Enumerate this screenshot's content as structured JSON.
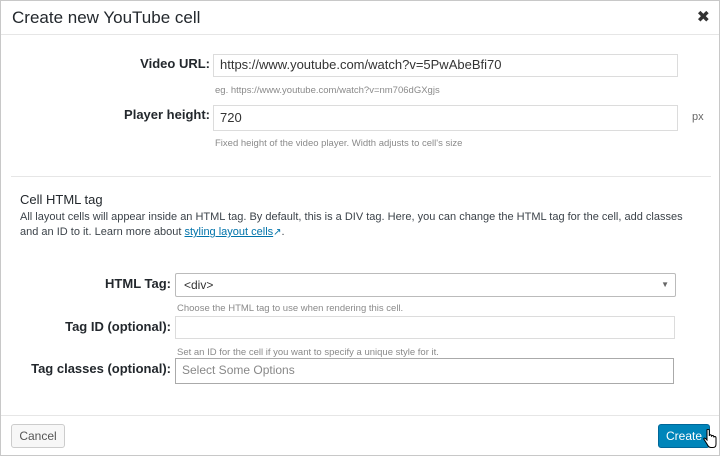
{
  "dialog": {
    "title": "Create new YouTube cell"
  },
  "icons": {
    "close": "close-icon",
    "external": "external-link-icon",
    "caret": "caret-down-icon",
    "cursor": "hand-cursor-icon"
  },
  "video_url": {
    "label": "Video URL:",
    "value": "https://www.youtube.com/watch?v=5PwAbeBfi70",
    "hint": "eg. https://www.youtube.com/watch?v=nm706dGXgjs"
  },
  "player_height": {
    "label": "Player height:",
    "value": "720",
    "unit": "px",
    "hint": "Fixed height of the video player. Width adjusts to cell's size"
  },
  "cell_html": {
    "title": "Cell HTML tag",
    "description": "All layout cells will appear inside an HTML tag. By default, this is a DIV tag. Here, you can change the HTML tag for the cell, add classes and an ID to it. Learn more about ",
    "link_text": "styling layout cells"
  },
  "html_tag": {
    "label": "HTML Tag:",
    "selected": "<div>",
    "hint": "Choose the HTML tag to use when rendering this cell."
  },
  "tag_id": {
    "label": "Tag ID (optional):",
    "value": "",
    "hint": "Set an ID for the cell if you want to specify a unique style for it."
  },
  "tag_classes": {
    "label": "Tag classes (optional):",
    "placeholder": "Select Some Options"
  },
  "footer": {
    "cancel_label": "Cancel",
    "create_label": "Create"
  },
  "colors": {
    "primary": "#0085ba",
    "link": "#0073aa"
  }
}
